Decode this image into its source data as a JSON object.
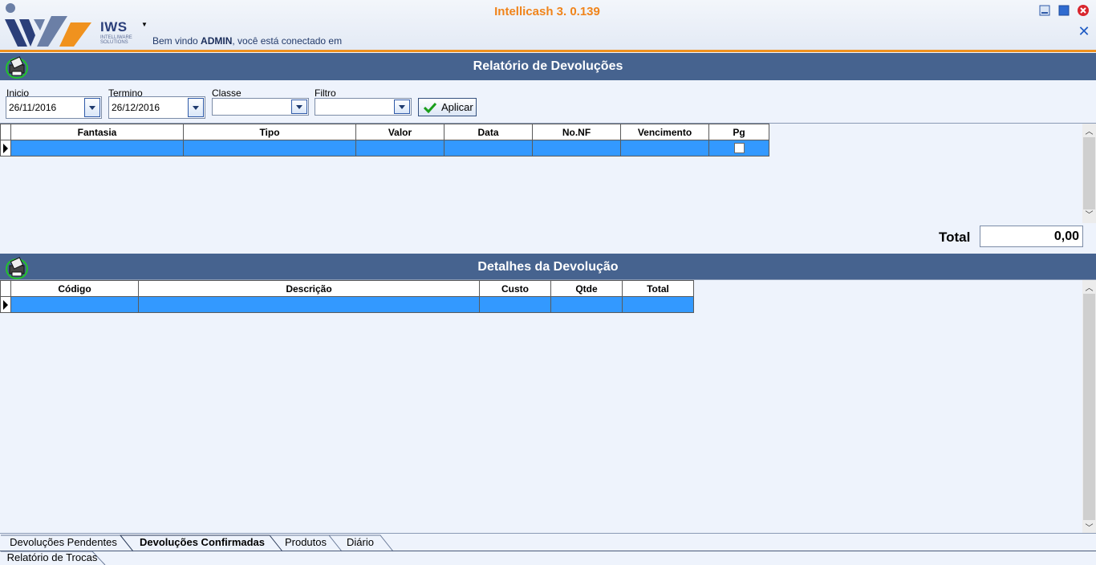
{
  "app": {
    "title": "Intellicash 3. 0.139",
    "logo_text": "IWS",
    "logo_sub": "INTELLIWARE SOLUTIONS",
    "welcome_prefix": "Bem vindo ",
    "welcome_user": "ADMIN",
    "welcome_suffix": ", você está conectado em"
  },
  "report": {
    "title": "Relatório de Devoluções",
    "filters": {
      "start_label": "Inicio",
      "start_value": "26/11/2016",
      "end_label": "Termino",
      "end_value": "26/12/2016",
      "class_label": "Classe",
      "class_value": "",
      "filter_label": "Filtro",
      "filter_value": "",
      "apply_label": "Aplicar"
    },
    "columns": [
      "Fantasia",
      "Tipo",
      "Valor",
      "Data",
      "No.NF",
      "Vencimento",
      "Pg"
    ],
    "total_label": "Total",
    "total_value": "0,00"
  },
  "details": {
    "title": "Detalhes da Devolução",
    "columns": [
      "Código",
      "Descrição",
      "Custo",
      "Qtde",
      "Total"
    ]
  },
  "tabs": {
    "row1": [
      "Devoluções Pendentes",
      "Devoluções Confirmadas",
      "Produtos",
      "Diário"
    ],
    "row2": [
      "Relatório de Trocas"
    ],
    "active": "Devoluções Confirmadas"
  },
  "colors": {
    "header_bar": "#46638f",
    "accent_orange": "#f0921e",
    "selected_row": "#3399ff"
  }
}
